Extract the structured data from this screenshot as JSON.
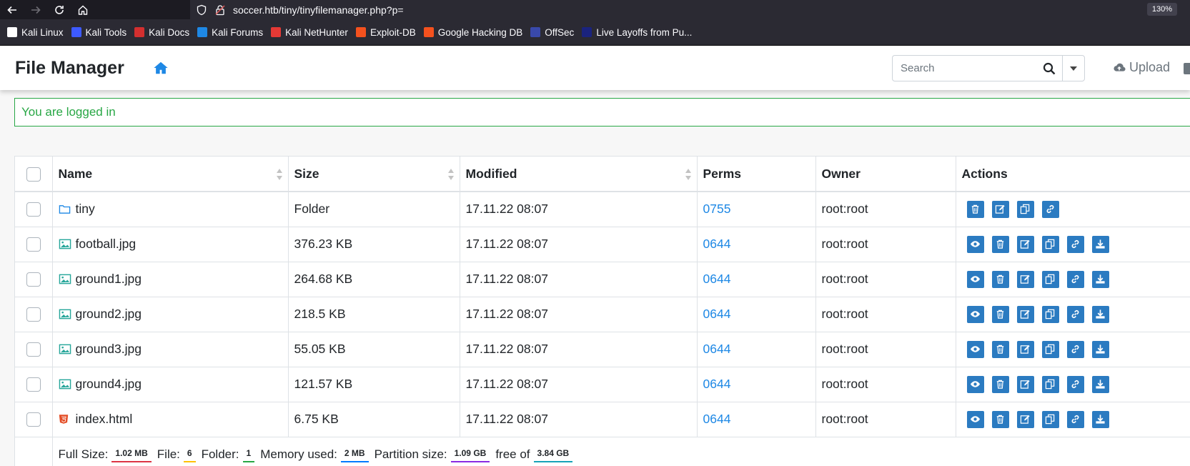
{
  "browser": {
    "url": "soccer.htb/tiny/tinyfilemanager.php?p=",
    "zoom": "130%",
    "bookmarks": [
      {
        "label": "Kali Linux",
        "icon": "kali-dragon-icon",
        "color": "#ffffff"
      },
      {
        "label": "Kali Tools",
        "icon": "kali-tools-icon",
        "color": "#3d5afe"
      },
      {
        "label": "Kali Docs",
        "icon": "kali-docs-icon",
        "color": "#d32f2f"
      },
      {
        "label": "Kali Forums",
        "icon": "kali-forums-icon",
        "color": "#1e88e5"
      },
      {
        "label": "Kali NetHunter",
        "icon": "nethunter-icon",
        "color": "#e53935"
      },
      {
        "label": "Exploit-DB",
        "icon": "exploit-db-icon",
        "color": "#f4511e"
      },
      {
        "label": "Google Hacking DB",
        "icon": "ghdb-icon",
        "color": "#f4511e"
      },
      {
        "label": "OffSec",
        "icon": "offsec-icon",
        "color": "#3949ab"
      },
      {
        "label": "Live Layoffs from Pu...",
        "icon": "layoffs-w-icon",
        "color": "#1a237e"
      }
    ]
  },
  "app": {
    "brand": "File Manager",
    "search_placeholder": "Search",
    "upload_label": "Upload",
    "alert": "You are logged in"
  },
  "table": {
    "columns": [
      "Name",
      "Size",
      "Modified",
      "Perms",
      "Owner",
      "Actions"
    ],
    "rows": [
      {
        "name": "tiny",
        "type": "folder",
        "size": "Folder",
        "modified": "17.11.22 08:07",
        "perms": "0755",
        "owner": "root:root"
      },
      {
        "name": "football.jpg",
        "type": "image",
        "size": "376.23 KB",
        "modified": "17.11.22 08:07",
        "perms": "0644",
        "owner": "root:root"
      },
      {
        "name": "ground1.jpg",
        "type": "image",
        "size": "264.68 KB",
        "modified": "17.11.22 08:07",
        "perms": "0644",
        "owner": "root:root"
      },
      {
        "name": "ground2.jpg",
        "type": "image",
        "size": "218.5 KB",
        "modified": "17.11.22 08:07",
        "perms": "0644",
        "owner": "root:root"
      },
      {
        "name": "ground3.jpg",
        "type": "image",
        "size": "55.05 KB",
        "modified": "17.11.22 08:07",
        "perms": "0644",
        "owner": "root:root"
      },
      {
        "name": "ground4.jpg",
        "type": "image",
        "size": "121.57 KB",
        "modified": "17.11.22 08:07",
        "perms": "0644",
        "owner": "root:root"
      },
      {
        "name": "index.html",
        "type": "html",
        "size": "6.75 KB",
        "modified": "17.11.22 08:07",
        "perms": "0644",
        "owner": "root:root"
      }
    ]
  },
  "footer": {
    "full_size_label": "Full Size:",
    "full_size": "1.02 MB",
    "file_label": "File:",
    "file_count": "6",
    "folder_label": "Folder:",
    "folder_count": "1",
    "memory_label": "Memory used:",
    "memory": "2 MB",
    "partition_label": "Partition size:",
    "partition": "1.09 GB",
    "free_label": "free of",
    "total": "3.84 GB"
  },
  "colors": {
    "accent": "#1e88e5",
    "action_button": "#2b7bc1",
    "alert_green": "#28a745",
    "badge_full_size": "#dc3545",
    "badge_file": "#ffc107",
    "badge_folder": "#28a745",
    "badge_memory": "#007bff",
    "badge_partition": "#8a2be2",
    "badge_total": "#17a2b8"
  }
}
